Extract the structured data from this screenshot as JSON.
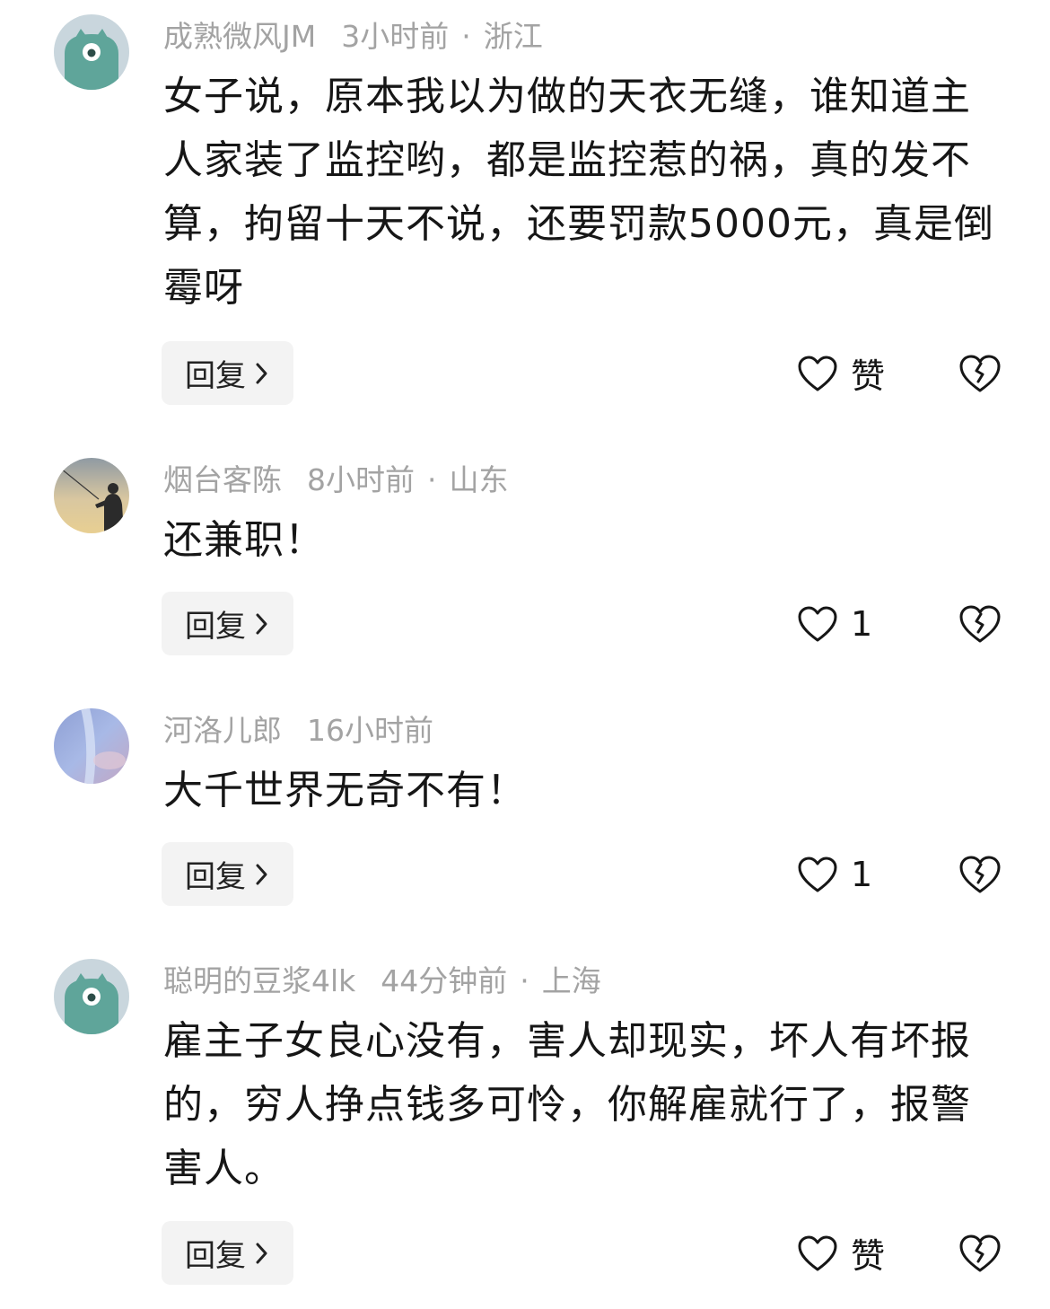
{
  "comments": [
    {
      "username": "成熟微风JM",
      "time": "3小时前",
      "dot": "·",
      "location": "浙江",
      "text": "女子说，原本我以为做的天衣无缝，谁知道主人家装了监控哟，都是监控惹的祸，真的发不算，拘留十天不说，还要罚款5000元，真是倒霉呀",
      "reply_label": "回复",
      "like_label": "赞",
      "avatar_icon": "teal-monster-avatar-icon"
    },
    {
      "username": "烟台客陈",
      "time": "8小时前",
      "dot": "·",
      "location": "山东",
      "text": "还兼职！",
      "reply_label": "回复",
      "like_label": "1",
      "avatar_icon": "fisherman-sunset-avatar-icon"
    },
    {
      "username": "河洛儿郎",
      "time": "16小时前",
      "text": "大千世界无奇不有！",
      "reply_label": "回复",
      "like_label": "1",
      "avatar_icon": "blue-sky-avatar-icon"
    },
    {
      "username": "聪明的豆浆4lk",
      "time": "44分钟前",
      "dot": "·",
      "location": "上海",
      "text": "雇主子女良心没有，害人却现实，坏人有坏报的，穷人挣点钱多可怜，你解雇就行了，报警害人。",
      "reply_label": "回复",
      "like_label": "赞",
      "avatar_icon": "teal-monster-avatar-icon"
    }
  ],
  "colors": {
    "meta_text": "#a3a3a3",
    "body_text": "#161616",
    "reply_bg": "#f3f3f3",
    "avatar_teal": "#5fa59a"
  }
}
